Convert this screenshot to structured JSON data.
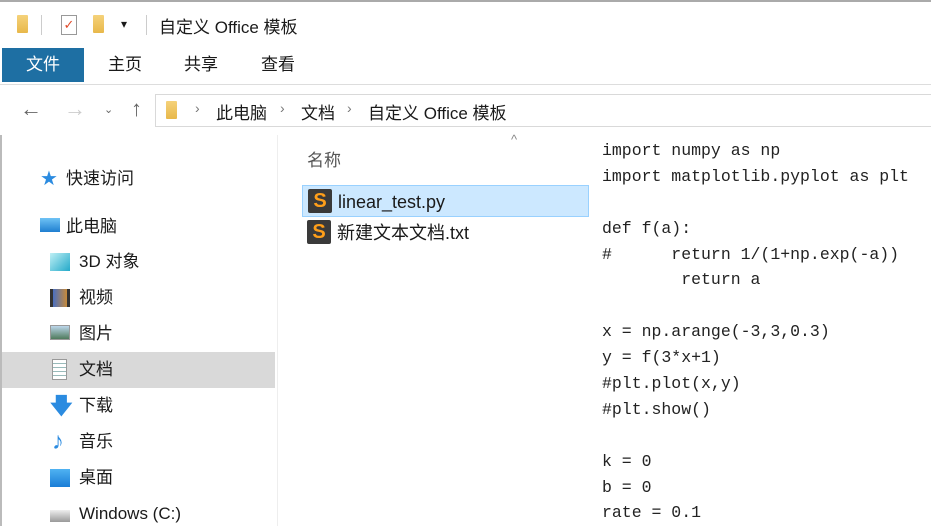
{
  "window": {
    "title": "自定义 Office 模板"
  },
  "ribbon": {
    "tabs": [
      "文件",
      "主页",
      "共享",
      "查看"
    ]
  },
  "address": {
    "crumbs": [
      "此电脑",
      "文档",
      "自定义 Office 模板"
    ]
  },
  "sidebar": {
    "items": [
      "快速访问",
      "此电脑",
      "3D 对象",
      "视频",
      "图片",
      "文档",
      "下载",
      "音乐",
      "桌面",
      "Windows (C:)"
    ],
    "selected": "文档"
  },
  "filelist": {
    "column": "名称",
    "files": [
      "linear_test.py",
      "新建文本文档.txt"
    ],
    "selected": "linear_test.py"
  },
  "preview": {
    "lines": [
      "import numpy as np",
      "import matplotlib.pyplot as plt",
      "",
      "def f(a):",
      "#      return 1/(1+np.exp(-a))",
      "        return a",
      "",
      "x = np.arange(-3,3,0.3)",
      "y = f(3*x+1)",
      "#plt.plot(x,y)",
      "#plt.show()",
      "",
      "k = 0",
      "b = 0",
      "rate = 0.1"
    ]
  },
  "colors": {
    "accent": "#1e6fa3",
    "selection": "#cce8ff",
    "sidebar_selected": "#d9d9d9"
  }
}
